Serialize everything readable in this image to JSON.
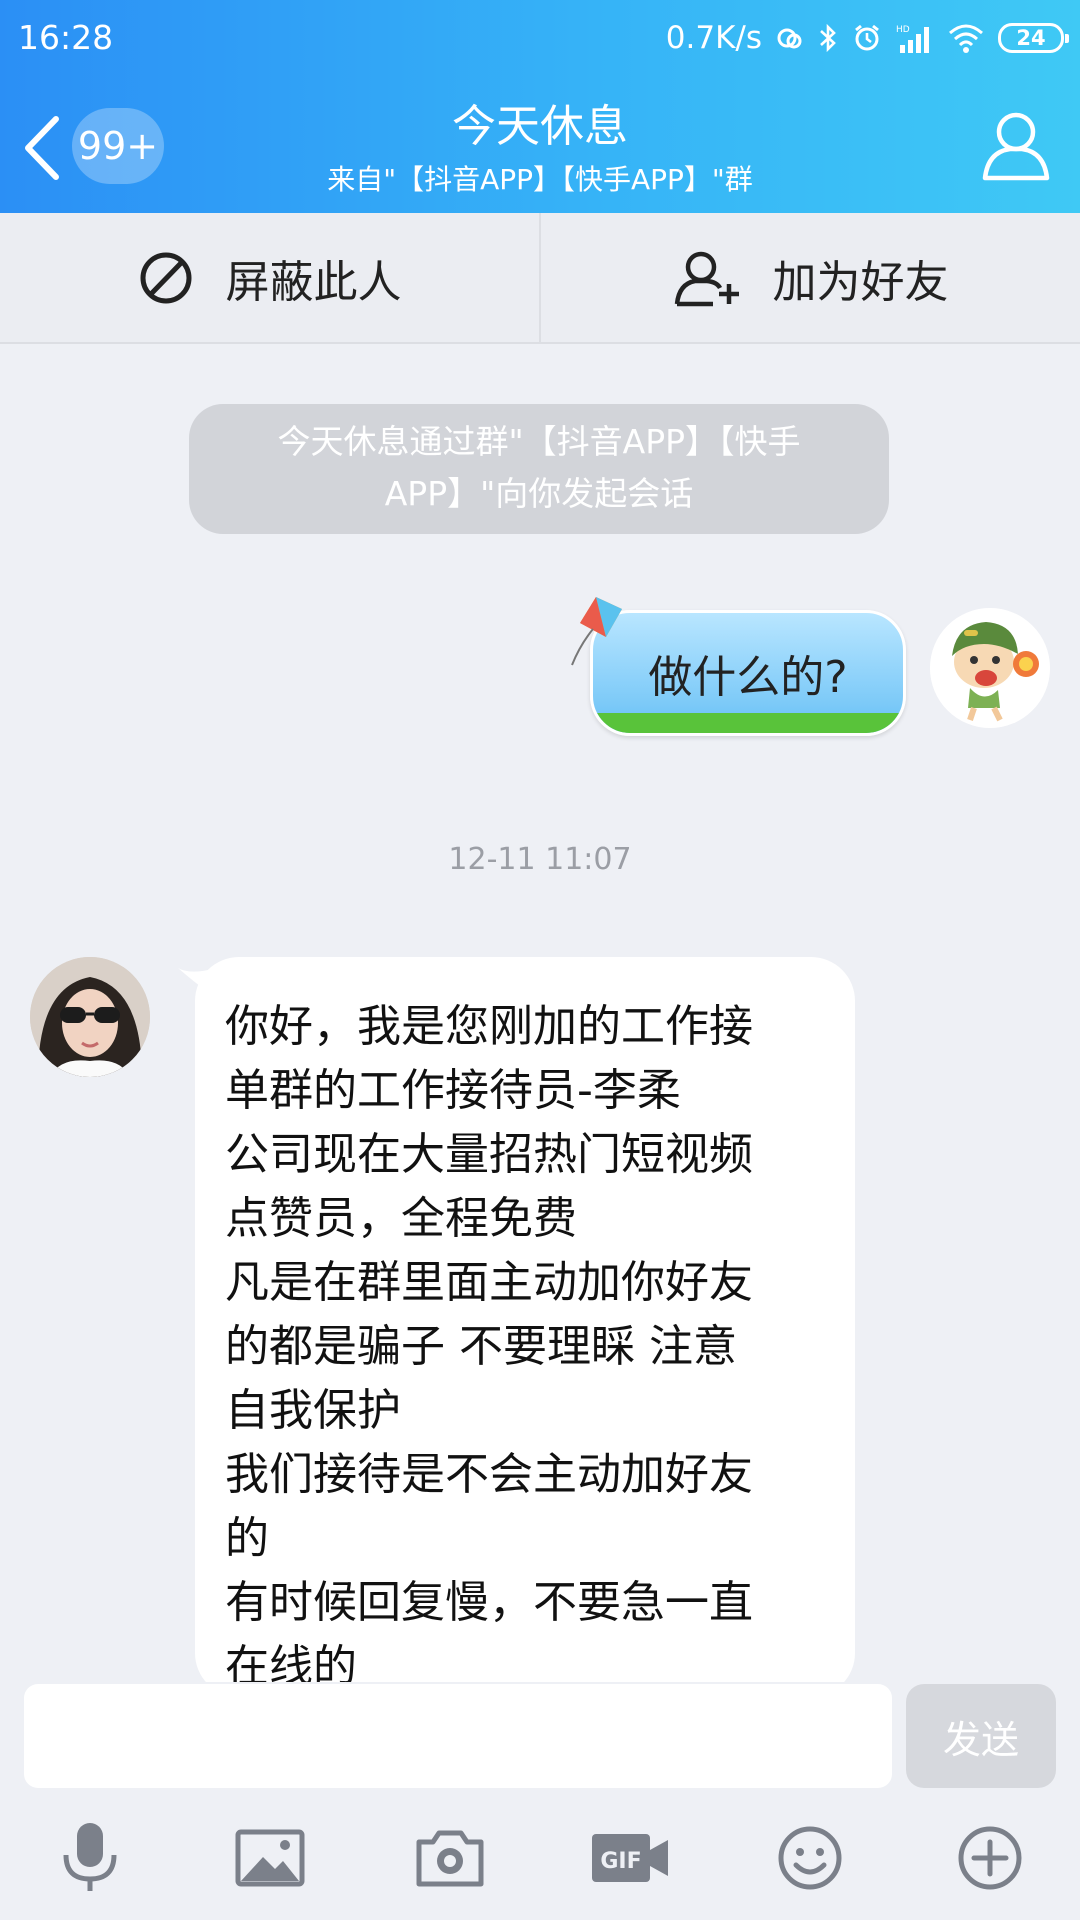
{
  "status_bar": {
    "time": "16:28",
    "net_speed": "0.7K/s",
    "battery": "24"
  },
  "header": {
    "badge": "99+",
    "title": "今天休息",
    "subtitle": "来自\"【抖音APP】【快手APP】\"群"
  },
  "actions": {
    "block_label": "屏蔽此人",
    "add_friend_label": "加为好友"
  },
  "messages": {
    "system_line1": "今天休息通过群\"【抖音APP】【快手",
    "system_line2": "APP】\"向你发起会话",
    "outgoing": "做什么的?",
    "timestamp": "12-11 11:07",
    "incoming_lines": [
      "你好，我是您刚加的工作接",
      "单群的工作接待员-李柔",
      "公司现在大量招热门短视频",
      "点赞员，全程免费",
      "凡是在群里面主动加你好友",
      "的都是骗子 不要理睬 注意",
      "自我保护",
      "我们接待是不会主动加好友",
      "的",
      "有时候回复慢，不要急一直",
      "在线的"
    ]
  },
  "input": {
    "value": "",
    "send_label": "发送"
  },
  "colors": {
    "header_start": "#2b8ff5",
    "header_end": "#3fc9f5",
    "chat_bg": "#eef0f5",
    "send_disabled": "#d6d8dd"
  }
}
